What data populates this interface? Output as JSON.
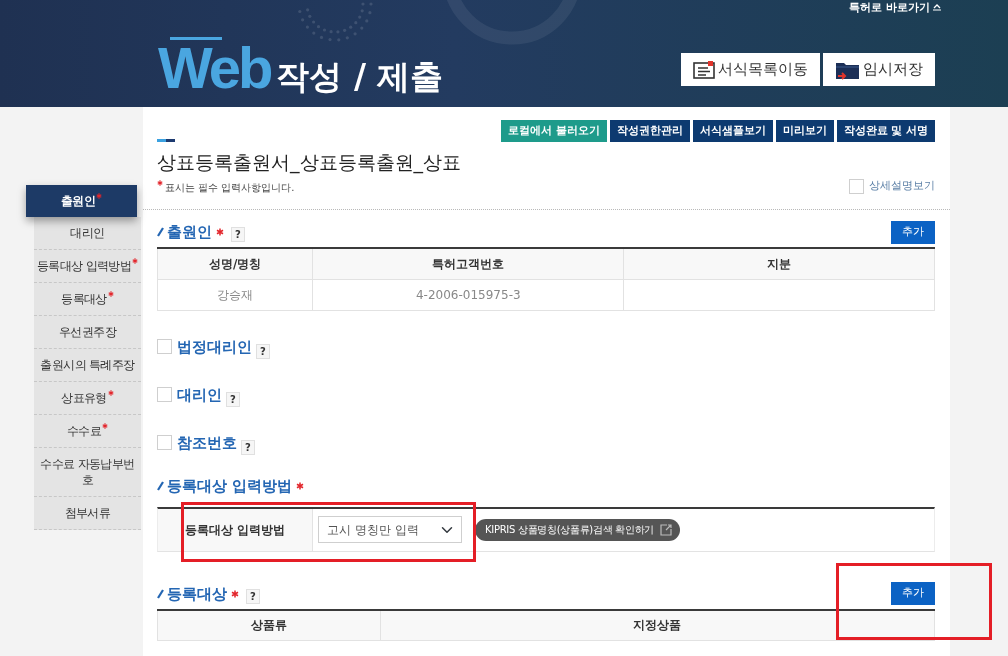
{
  "header": {
    "shortcut_link": "특허로 바로가기",
    "logo": "Web",
    "title": "작성 / 제출",
    "buttons": [
      {
        "label": "서식목록이동",
        "kind": "document"
      },
      {
        "label": "임시저장",
        "kind": "folder"
      }
    ]
  },
  "sidebar": {
    "items": [
      {
        "label": "출원인",
        "required": true,
        "selected": true
      },
      {
        "label": "대리인",
        "required": false,
        "selected": false
      },
      {
        "label": "등록대상 입력방법",
        "required": true,
        "selected": false
      },
      {
        "label": "등록대상",
        "required": true,
        "selected": false
      },
      {
        "label": "우선권주장",
        "required": false,
        "selected": false
      },
      {
        "label": "출원시의 특례주장",
        "required": false,
        "selected": false
      },
      {
        "label": "상표유형",
        "required": true,
        "selected": false
      },
      {
        "label": "수수료",
        "required": true,
        "selected": false
      },
      {
        "label": "수수료 자동납부번호",
        "required": false,
        "selected": false
      },
      {
        "label": "첨부서류",
        "required": false,
        "selected": false
      }
    ]
  },
  "toolbar": {
    "buttons": [
      {
        "label": "로컬에서 불러오기",
        "kind": "accent"
      },
      {
        "label": "작성권한관리",
        "kind": "default"
      },
      {
        "label": "서식샘플보기",
        "kind": "default"
      },
      {
        "label": "미리보기",
        "kind": "default"
      },
      {
        "label": "작성완료 및 서명",
        "kind": "default"
      }
    ]
  },
  "form": {
    "title": "상표등록출원서_상표등록출원_상표",
    "required_note": "표시는 필수 입력사항입니다.",
    "detail_toggle": {
      "label": "상세설명보기",
      "checked": false
    }
  },
  "sections": [
    {
      "kind": "table",
      "title": "출원인",
      "required": true,
      "help": "?",
      "add_button": "추가",
      "columns": [
        "성명/명칭",
        "특허고객번호",
        "지분"
      ],
      "rows": [
        [
          "강승재",
          "4-2006-015975-3"
        ]
      ]
    },
    {
      "kind": "checkbox",
      "title": "법정대리인",
      "checked": false,
      "help": "?"
    },
    {
      "kind": "checkbox",
      "title": "대리인",
      "checked": false,
      "help": "?"
    },
    {
      "kind": "checkbox",
      "title": "참조번호",
      "checked": false,
      "help": "?"
    },
    {
      "kind": "field",
      "title": "등록대상 입력방법",
      "required": true,
      "field_label": "등록대상 입력방법",
      "value": "고시 명칭만 입력",
      "search_button": "KIPRIS 상품명칭(상품류)검색 확인하기",
      "highlighted": true
    },
    {
      "kind": "table",
      "title": "등록대상",
      "required": true,
      "help": "?",
      "add_button": "추가",
      "add_highlighted": true,
      "columns": [
        "상품류",
        "지정상품"
      ]
    }
  ]
}
